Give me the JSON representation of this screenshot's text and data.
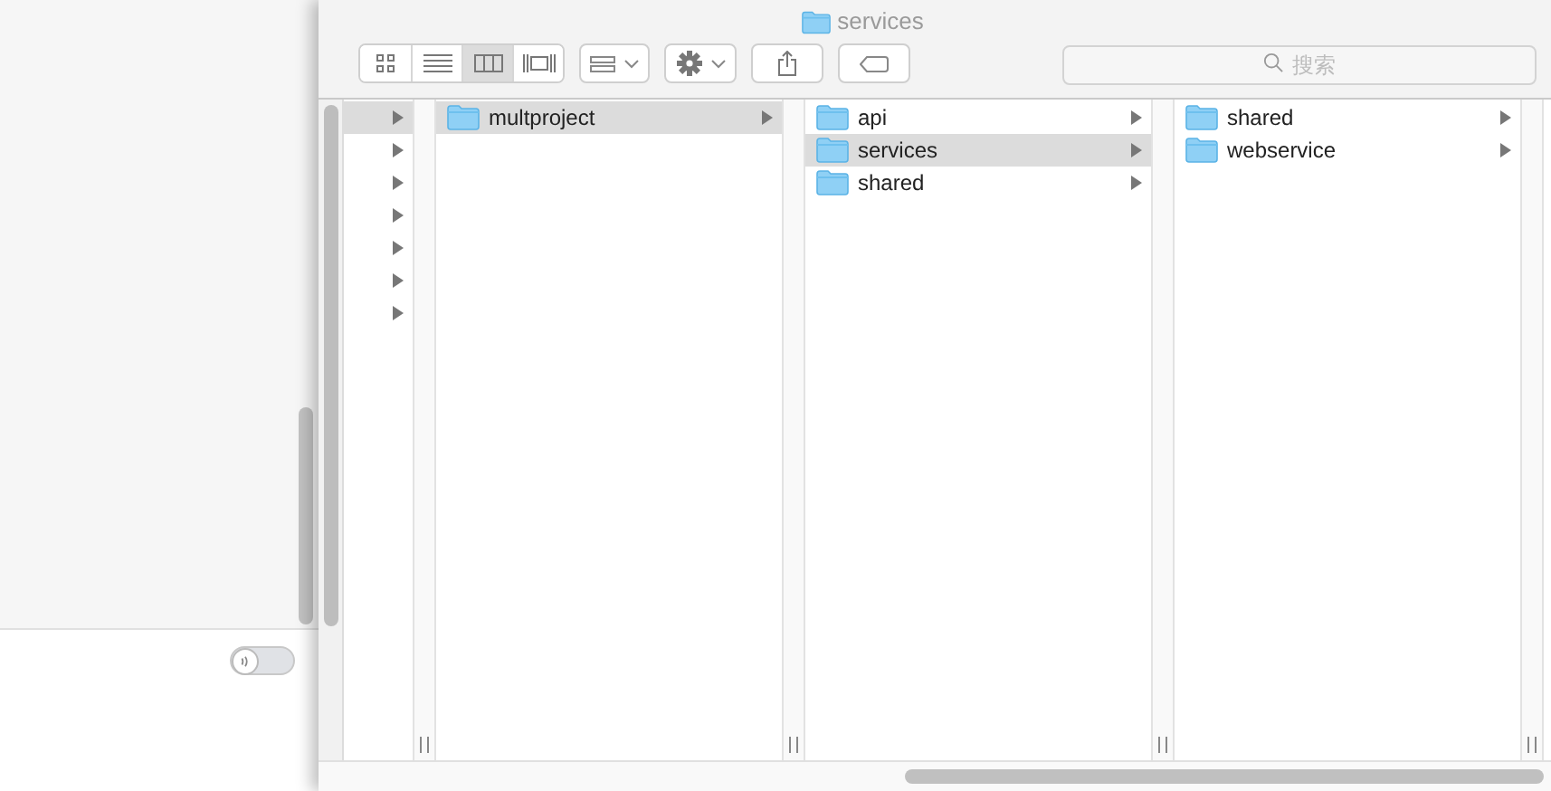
{
  "window": {
    "title": "services"
  },
  "toolbar": {
    "view_buttons": [
      {
        "kind": "icons",
        "selected": false
      },
      {
        "kind": "list",
        "selected": false
      },
      {
        "kind": "columns",
        "selected": true
      },
      {
        "kind": "coverflow",
        "selected": false
      }
    ],
    "search": {
      "placeholder": "搜索"
    }
  },
  "side_panel": {
    "toggle": {
      "on": false
    }
  },
  "columns": [
    {
      "items": [
        {
          "selected": true
        },
        {
          "selected": false
        },
        {
          "selected": false
        },
        {
          "selected": false
        },
        {
          "selected": false
        },
        {
          "selected": false
        },
        {
          "selected": false
        }
      ]
    },
    {
      "items": [
        {
          "name": "multproject",
          "selected": true
        }
      ]
    },
    {
      "items": [
        {
          "name": "api",
          "selected": false
        },
        {
          "name": "services",
          "selected": true
        },
        {
          "name": "shared",
          "selected": false
        }
      ]
    },
    {
      "items": [
        {
          "name": "shared",
          "selected": false
        },
        {
          "name": "webservice",
          "selected": false
        }
      ]
    }
  ]
}
